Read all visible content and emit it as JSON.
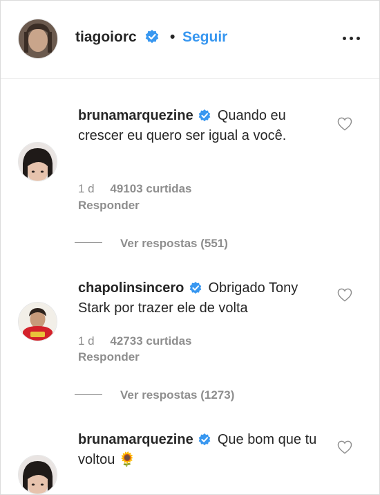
{
  "header": {
    "username": "tiagoiorc",
    "separator": "•",
    "follow_label": "Seguir"
  },
  "comments": [
    {
      "username": "brunamarquezine",
      "text": "Quando eu crescer eu quero ser igual a você.",
      "time": "1 d",
      "likes": "49103 curtidas",
      "reply_label": "Responder",
      "view_replies": "Ver respostas (551)"
    },
    {
      "username": "chapolinsincero",
      "text": "Obrigado Tony Stark por trazer ele de volta",
      "time": "1 d",
      "likes": "42733 curtidas",
      "reply_label": "Responder",
      "view_replies": "Ver respostas (1273)"
    },
    {
      "username": "brunamarquezine",
      "text": "Que bom que tu voltou 🌻"
    }
  ],
  "colors": {
    "link_blue": "#3897f0",
    "verified_blue": "#3897f0",
    "muted_gray": "#8e8e8e",
    "text": "#262626"
  },
  "icons": [
    "verified-badge-icon",
    "more-options-icon",
    "heart-icon"
  ]
}
